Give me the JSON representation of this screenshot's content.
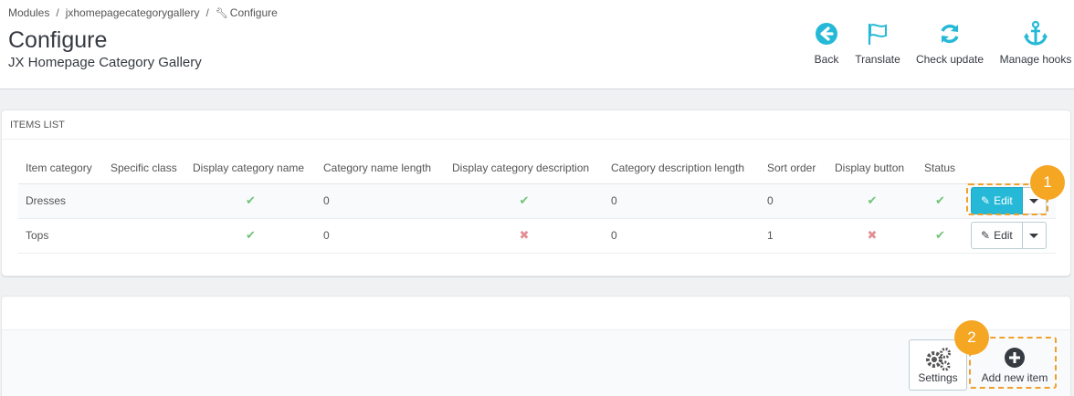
{
  "breadcrumb": {
    "items": [
      "Modules",
      "jxhomepagecategorygallery",
      "Configure"
    ]
  },
  "header": {
    "title": "Configure",
    "subtitle": "JX Homepage Category Gallery"
  },
  "toolbar": {
    "back": "Back",
    "translate": "Translate",
    "check_update": "Check update",
    "manage_hooks": "Manage hooks"
  },
  "items_panel": {
    "heading": "ITEMS LIST",
    "columns": [
      "Item category",
      "Specific class",
      "Display category name",
      "Category name length",
      "Display category description",
      "Category description length",
      "Sort order",
      "Display button",
      "Status"
    ],
    "rows": [
      {
        "item_category": "Dresses",
        "specific_class": "",
        "display_category_name": "yes",
        "category_name_length": "0",
        "display_category_description": "yes",
        "category_description_length": "0",
        "sort_order": "0",
        "display_button": "yes",
        "status": "yes",
        "action": "Edit"
      },
      {
        "item_category": "Tops",
        "specific_class": "",
        "display_category_name": "yes",
        "category_name_length": "0",
        "display_category_description": "no",
        "category_description_length": "0",
        "sort_order": "1",
        "display_button": "no",
        "status": "yes",
        "action": "Edit"
      }
    ]
  },
  "footer_panel": {
    "settings": "Settings",
    "add_new_item": "Add new item"
  },
  "annotations": {
    "badge_1": "1",
    "badge_2": "2"
  },
  "colors": {
    "accent": "#25b9d7",
    "highlight": "#f5a623",
    "check": "#72c279",
    "cross": "#e08f95"
  }
}
